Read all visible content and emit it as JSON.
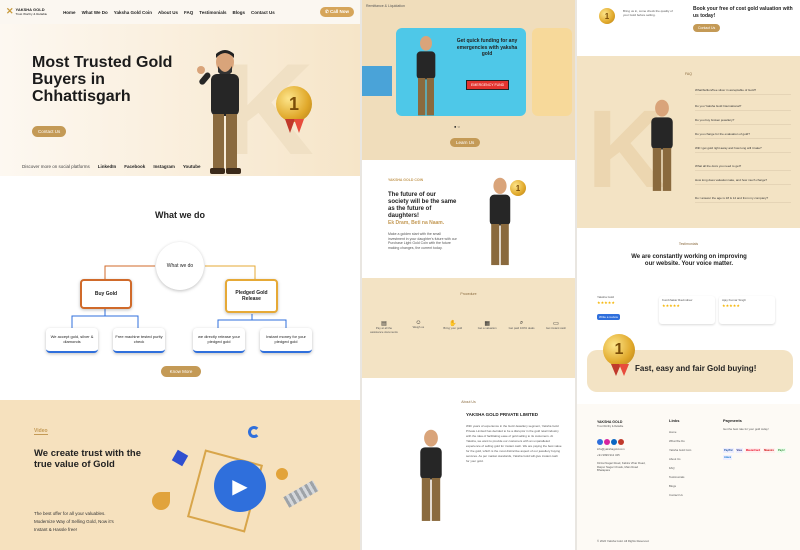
{
  "nav": {
    "brand": "YAKSHA GOLD",
    "brand_sub": "Trust Worthy & Reliable",
    "links": [
      "Home",
      "What We Do",
      "Yaksha Gold Coin",
      "About Us",
      "FAQ",
      "Testimonials",
      "Blogs",
      "Contact Us"
    ],
    "call": "Call Now"
  },
  "hero": {
    "title": "Most Trusted Gold Buyers in Chhattisgarh",
    "cta": "Contact Us",
    "social_label": "Discover more on social platforms",
    "social": [
      "LinkedIn",
      "Facebook",
      "Instagram",
      "Youtube"
    ],
    "medal": "1"
  },
  "what_we_do": {
    "title": "What we do",
    "center": "What we do",
    "left": "Buy Gold",
    "right": "Pledged Gold Release",
    "items": [
      "We accept gold, silver & diamonds",
      "Free machine tested purity check",
      "we directly release your pledged gold",
      "Instant money for your pledged gold"
    ],
    "more": "Know More"
  },
  "video": {
    "tag": "Video",
    "title": "We create trust with the true value of Gold",
    "body": "The best offer for all your valuables. Modernize Way of Selling Gold, Now it's Instant & Hassle free!"
  },
  "col2": {
    "breadcrumb": "Remittance & Liquidation",
    "slide_title": "Get quick funding for any emergencies with yaksha gold",
    "slide_badge": "EMERGENCY FUND",
    "learn": "Learn Us",
    "coin_tag": "YAKSHA GOLD COIN",
    "coin_title": "The future of our society will be the same as the future of daughters!",
    "coin_sub": "Ek Dram, Beti na Naam.",
    "coin_body": "Make a golden start with the small investment in your daughter's future with our Purchase Light Gold Coin with the future making changes, the current today.",
    "process_tag": "Procedure",
    "process": [
      "Pay at all the assistance documents",
      "Weigh us",
      "Bring your gold",
      "Get a valuation",
      "Get paid 100% deals",
      "Get instant cash"
    ],
    "about_tag": "About Us",
    "about_title": "YAKSHA GOLD PRIVATE LIMITED",
    "about_body": "With years of experience in the Gold Jewellery segment, Yaksha Gold Private Limited has decided to be a disruptor in the gold retail industry with the idea of facilitating ease of gold selling to its customers. At Yaksha, we want to provide our customers with an unparalleled experience of selling gold for instant cash. We are paying the best value for the gold, which is the most distinctive aspect of our jewellery buying services. As per market standards, Yaksha Gold will give instant cash for your gold."
  },
  "col3": {
    "promo_text": "Bring us in, come check the quality of your Gold before selling.",
    "promo_title": "Book your free of cost gold valuation with us today!",
    "promo_btn": "Contact Us",
    "faq_tag": "FAQ",
    "faqs": [
      "What/bullion/free silver in acceptable of Gold?",
      "Do you Yaksha Gold International?",
      "Do you buy broken jewellery?",
      "Do you charge for the evaluation of gold?",
      "Will I get gold right away and how long will it take?",
      "What all the docs you need to get?",
      "How long does valuation take, and how much charge?",
      "Do I answer the age is 18 & 14 and from my company?"
    ],
    "testi_tag": "Testimonials",
    "testi_title": "We are constantly working on improving our website. Your voice matter.",
    "reviewers": [
      "Yaksha Gold",
      "Kumbhakar Ravindrew",
      "Ajay Kumar Singh"
    ],
    "review_btn": "Write a review",
    "banner": "Fast, easy and fair Gold buying!",
    "banner_medal": "1",
    "footer_brand": "YAKSHA GOLD",
    "footer_sub": "Trust Worthy & Reliable",
    "links_title": "Links",
    "links": [
      "Home",
      "What We Do",
      "Yaksha Gold Coin",
      "About Us",
      "FAQ",
      "Testimonials",
      "Blogs",
      "Contact Us"
    ],
    "pay_title": "Payments",
    "pay_text": "Get the best rate for your gold today!",
    "pay_methods": [
      "PayPal",
      "Visa",
      "MasterCard",
      "Maestro",
      "PayU",
      "Amex"
    ],
    "phone": "+91 9999 912 345",
    "address": "91/Jai Nagar Road, Kabira Vihar Road, Raipur Nagar Chowk, Main Road Bhatapara",
    "email": "info@yakshagold.com",
    "copyright": "© 2022 Yaksha Gold. All Rights Reserved."
  },
  "colors": {
    "gold": "#c49a56",
    "cream": "#f6e1be",
    "blue": "#2f6fdc",
    "dark": "#1b1b1b"
  }
}
